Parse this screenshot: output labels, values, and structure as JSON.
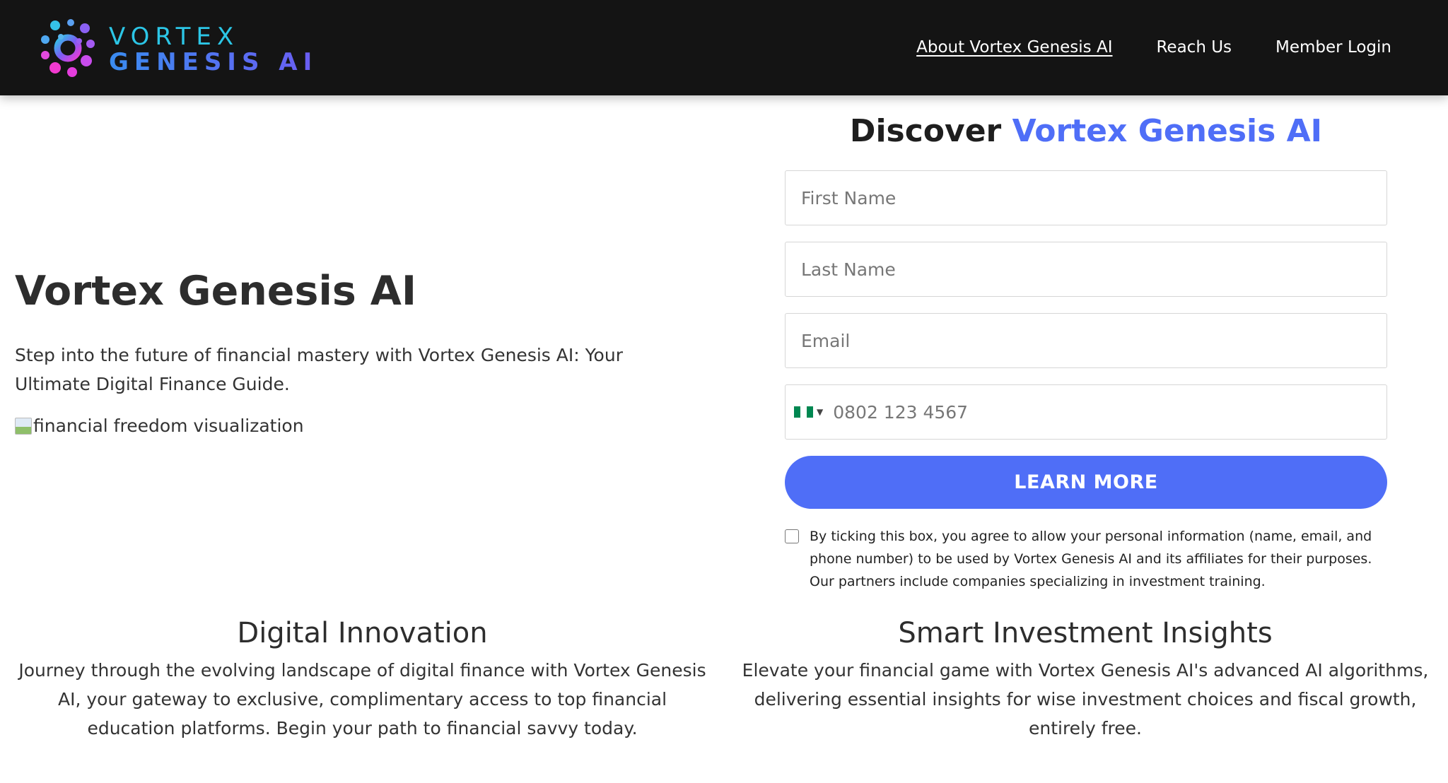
{
  "header": {
    "brand_line1": "VORTEX",
    "brand_line2": "GENESIS AI",
    "nav": [
      {
        "label": "About Vortex Genesis AI",
        "active": true
      },
      {
        "label": "Reach Us",
        "active": false
      },
      {
        "label": "Member Login",
        "active": false
      }
    ]
  },
  "hero": {
    "title": "Vortex Genesis AI",
    "subtitle": "Step into the future of financial mastery with Vortex Genesis AI: Your Ultimate Digital Finance Guide.",
    "image_alt": "financial freedom visualization"
  },
  "form": {
    "title_prefix": "Discover",
    "title_accent": "Vortex Genesis AI",
    "first_name_placeholder": "First Name",
    "last_name_placeholder": "Last Name",
    "email_placeholder": "Email",
    "phone_placeholder": "0802 123 4567",
    "country_flag": "nigeria-flag-icon",
    "submit_label": "LEARN MORE",
    "consent_text": "By ticking this box, you agree to allow your personal information (name, email, and phone number) to be used by Vortex Genesis AI and its affiliates for their purposes. Our partners include companies specializing in investment training.",
    "consent_checked": false
  },
  "features": [
    {
      "title": "Digital Innovation",
      "body": "Journey through the evolving landscape of digital finance with Vortex Genesis AI, your gateway to exclusive, complimentary access to top financial education platforms. Begin your path to financial savvy today."
    },
    {
      "title": "Smart Investment Insights",
      "body": "Elevate your financial game with Vortex Genesis AI's advanced AI algorithms, delivering essential insights for wise investment choices and fiscal growth, entirely free."
    }
  ],
  "colors": {
    "header_bg": "#141414",
    "accent": "#4f6ef7",
    "brand_cyan": "#2cc6e6",
    "flag_green": "#008751"
  }
}
